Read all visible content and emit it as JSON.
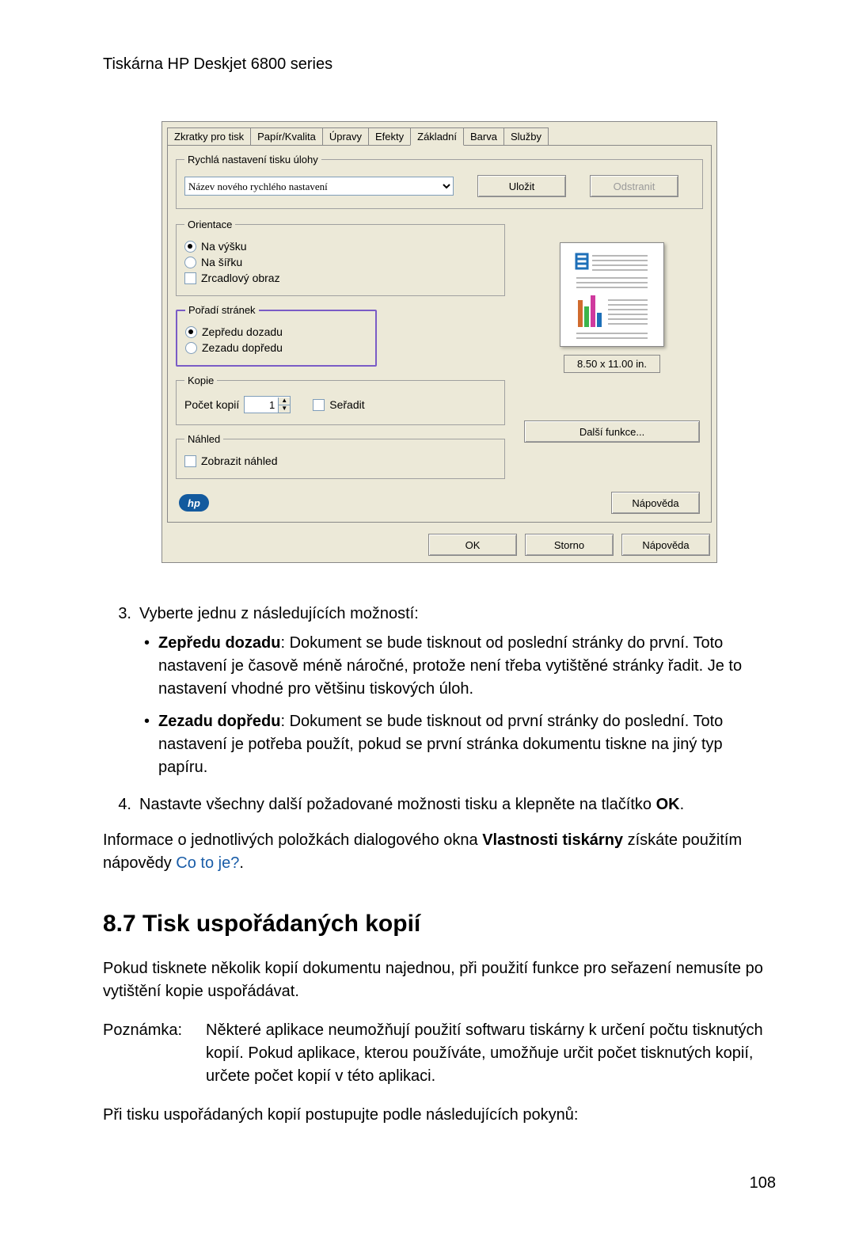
{
  "doc": {
    "header": "Tiskárna HP Deskjet 6800 series",
    "step3_lead": "Vyberte jednu z následujících možností:",
    "bullet1_bold": "Zepředu dozadu",
    "bullet1_rest": ": Dokument se bude tisknout od poslední stránky do první. Toto nastavení je časově méně náročné, protože není třeba vytištěné stránky řadit. Je to nastavení vhodné pro většinu tiskových úloh.",
    "bullet2_bold": "Zezadu dopředu",
    "bullet2_rest": ": Dokument se bude tisknout od první stránky do poslední. Toto nastavení je potřeba použít, pokud se první stránka dokumentu tiskne na jiný typ papíru.",
    "step4_pre": "Nastavte všechny další požadované možnosti tisku a klepněte na tlačítko ",
    "step4_bold": "OK",
    "step4_post": ".",
    "info_pre": "Informace o jednotlivých položkách dialogového okna ",
    "info_bold": "Vlastnosti tiskárny",
    "info_mid": " získáte použitím nápovědy ",
    "info_link": "Co to je?",
    "info_post": ".",
    "section_heading": "8.7  Tisk uspořádaných kopií",
    "section_para": "Pokud tisknete několik kopií dokumentu najednou, při použití funkce pro seřazení nemusíte po vytištění kopie uspořádávat.",
    "note_label": "Poznámka:",
    "note_body": "Některé aplikace neumožňují použití softwaru tiskárny k určení počtu tisknutých kopií. Pokud aplikace, kterou používáte, umožňuje určit počet tisknutých kopií, určete počet kopií v této aplikaci.",
    "closing": "Při tisku uspořádaných kopií postupujte podle následujících pokynů:",
    "page_number": "108"
  },
  "dialog": {
    "tabs": [
      "Zkratky pro tisk",
      "Papír/Kvalita",
      "Úpravy",
      "Efekty",
      "Základní",
      "Barva",
      "Služby"
    ],
    "active_tab_index": 4,
    "quick_legend": "Rychlá nastavení tisku úlohy",
    "quick_placeholder": "Název nového rychlého nastavení",
    "save": "Uložit",
    "delete": "Odstranit",
    "orient_legend": "Orientace",
    "orient_portrait": "Na výšku",
    "orient_landscape": "Na šířku",
    "orient_mirror": "Zrcadlový obraz",
    "order_legend": "Pořadí stránek",
    "order_front": "Zepředu dozadu",
    "order_back": "Zezadu dopředu",
    "copies_legend": "Kopie",
    "copies_label": "Počet kopií",
    "copies_value": "1",
    "collate": "Seřadit",
    "preview_legend": "Náhled",
    "preview_show": "Zobrazit náhled",
    "dim": "8.50 x 11.00 in.",
    "more": "Další funkce...",
    "help_side": "Nápověda",
    "hp": "hp",
    "ok": "OK",
    "cancel": "Storno",
    "help": "Nápověda"
  }
}
